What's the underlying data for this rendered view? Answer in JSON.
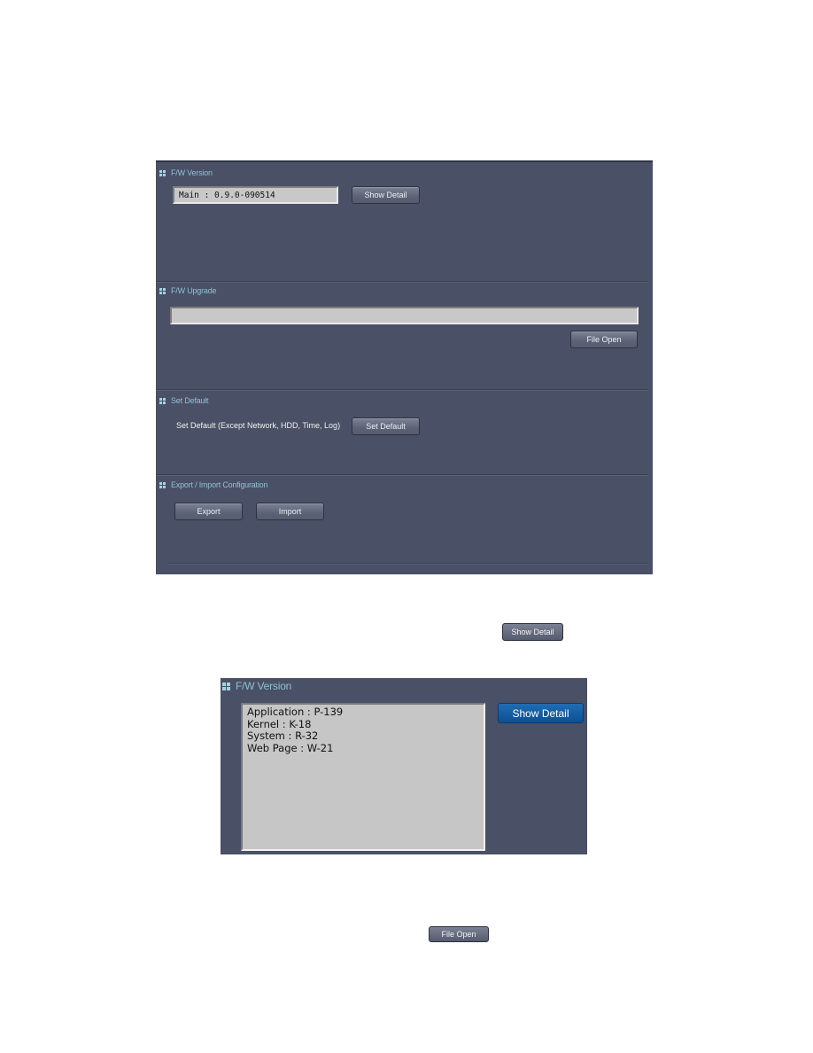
{
  "main_panel": {
    "fw_version": {
      "title": "F/W Version",
      "main_value": "Main : 0.9.0-090514",
      "show_detail_label": "Show Detail"
    },
    "fw_upgrade": {
      "title": "F/W Upgrade",
      "file_path_value": "",
      "file_open_label": "File Open"
    },
    "set_default": {
      "title": "Set Default",
      "description": "Set Default (Except Network, HDD, Time, Log)",
      "button_label": "Set Default"
    },
    "export_import": {
      "title": "Export / Import Configuration",
      "export_label": "Export",
      "import_label": "Import"
    }
  },
  "inline_buttons": {
    "show_detail_label": "Show Detail",
    "file_open_label": "File Open"
  },
  "detail_panel": {
    "title": "F/W Version",
    "lines": [
      "Application : P-139",
      "Kernel : K-18",
      "System : R-32",
      "Web Page : W-21"
    ],
    "show_detail_label": "Show Detail"
  },
  "colors": {
    "panel_bg": "#4a5065",
    "section_title": "#8fc1d6",
    "field_bg": "#c8c8c8",
    "active_button": "#1a63a8"
  }
}
